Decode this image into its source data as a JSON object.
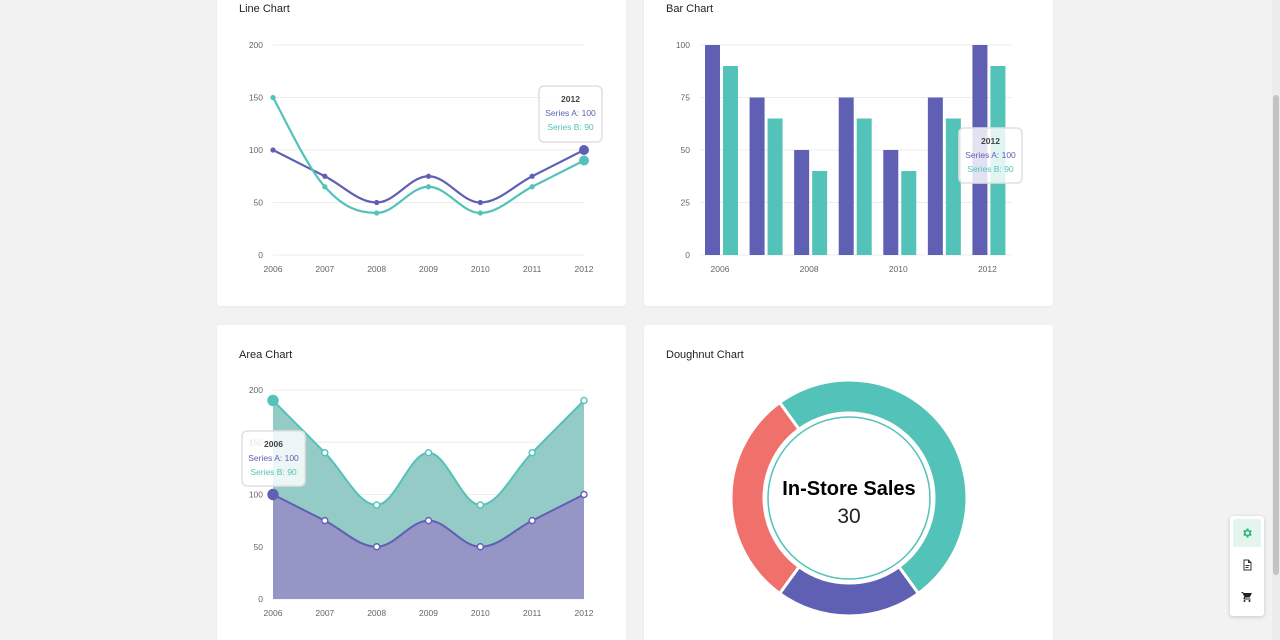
{
  "cards": {
    "line": {
      "title": "Line Chart"
    },
    "bar": {
      "title": "Bar Chart"
    },
    "area": {
      "title": "Area Chart"
    },
    "doughnut": {
      "title": "Doughnut Chart"
    }
  },
  "colors": {
    "series_a": "#5f60b4",
    "series_b": "#53c2b8",
    "doughnut_red": "#f0716c"
  },
  "chart_data": [
    {
      "type": "line",
      "x": [
        "2006",
        "2007",
        "2008",
        "2009",
        "2010",
        "2011",
        "2012"
      ],
      "series": [
        {
          "name": "Series A",
          "values": [
            100,
            75,
            50,
            75,
            50,
            75,
            100
          ]
        },
        {
          "name": "Series B",
          "values": [
            150,
            65,
            40,
            65,
            40,
            65,
            90
          ]
        }
      ],
      "ylim": [
        0,
        200
      ],
      "yticks": [
        "0",
        "50",
        "100",
        "150",
        "200"
      ],
      "grid": true,
      "tooltip": {
        "title": "2012",
        "series_a": "Series A: 100",
        "series_b": "Series B: 90"
      }
    },
    {
      "type": "bar",
      "x": [
        "2006",
        "2007",
        "2008",
        "2009",
        "2010",
        "2011",
        "2012"
      ],
      "xtick_labels": [
        "2006",
        "2008",
        "2010",
        "2012"
      ],
      "series": [
        {
          "name": "Series A",
          "values": [
            100,
            75,
            50,
            75,
            50,
            75,
            100
          ]
        },
        {
          "name": "Series B",
          "values": [
            90,
            65,
            40,
            65,
            40,
            65,
            90
          ]
        }
      ],
      "ylim": [
        0,
        100
      ],
      "yticks": [
        "0",
        "25",
        "50",
        "75",
        "100"
      ],
      "grid": true,
      "tooltip": {
        "title": "2012",
        "series_a": "Series A: 100",
        "series_b": "Series B: 90"
      }
    },
    {
      "type": "area",
      "x": [
        "2006",
        "2007",
        "2008",
        "2009",
        "2010",
        "2011",
        "2012"
      ],
      "series": [
        {
          "name": "Series A",
          "values": [
            100,
            75,
            50,
            75,
            50,
            75,
            100
          ]
        },
        {
          "name": "Series B",
          "values": [
            90,
            65,
            40,
            65,
            40,
            65,
            90
          ]
        }
      ],
      "stacked": true,
      "ylim": [
        0,
        200
      ],
      "yticks": [
        "0",
        "50",
        "100",
        "150",
        "200"
      ],
      "grid": true,
      "tooltip": {
        "title": "2006",
        "series_a": "Series A: 100",
        "series_b": "Series B: 90"
      }
    },
    {
      "type": "pie",
      "variant": "doughnut",
      "segments": [
        {
          "value": 50,
          "color": "#53c2b8"
        },
        {
          "value": 20,
          "color": "#5f60b4"
        },
        {
          "value": 30,
          "color": "#f0716c"
        }
      ],
      "center_label": "In-Store Sales",
      "center_value": "30"
    }
  ],
  "fab": [
    "gear-icon",
    "document-icon",
    "cart-icon"
  ]
}
